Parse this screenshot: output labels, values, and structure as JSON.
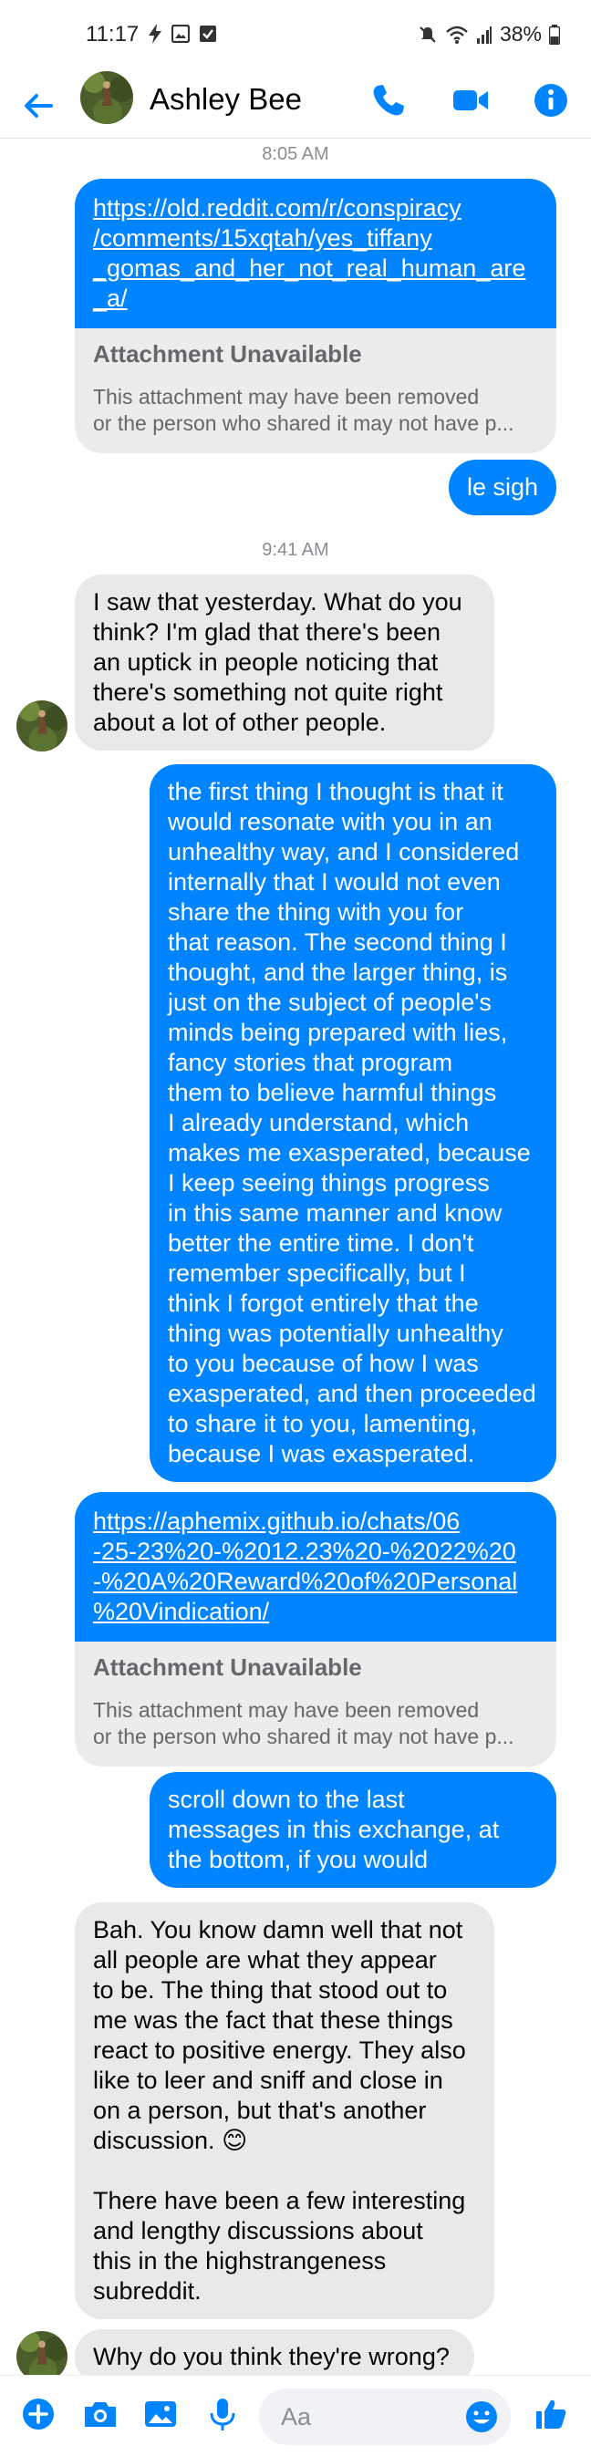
{
  "status_bar": {
    "time": "11:17",
    "battery": "38%",
    "icons": [
      "flash-icon",
      "gallery-icon",
      "checkbox-icon",
      "mute-icon",
      "wifi-icon",
      "signal-icon",
      "battery-icon"
    ]
  },
  "header": {
    "contact_name": "Ashley Bee",
    "icons": [
      "back-arrow-icon",
      "phone-icon",
      "video-icon",
      "info-icon"
    ]
  },
  "colors": {
    "accent": "#0084ff",
    "incoming_bubble": "#e9e9eb",
    "attachment_bg": "#ececec",
    "muted_text": "#65676b"
  },
  "messages": [
    {
      "type": "timestamp",
      "text": "8:05 AM"
    },
    {
      "type": "link_share",
      "direction": "out",
      "url_lines": [
        "https://old.reddit.com/r/conspiracy",
        "/comments/15xqtah/yes_tiffany",
        "_gomas_and_her_not_real_human_are",
        "_a/"
      ],
      "attachment_title": "Attachment Unavailable",
      "attachment_desc_lines": [
        "This attachment may have been removed",
        "or the person who shared it may not have p..."
      ]
    },
    {
      "type": "text",
      "direction": "out",
      "lines": [
        "le sigh"
      ]
    },
    {
      "type": "timestamp",
      "text": "9:41 AM"
    },
    {
      "type": "text",
      "direction": "in",
      "lines": [
        "I saw that yesterday. What do you",
        "think? I'm glad that there's been",
        "an uptick in people noticing that",
        "there's something not quite right",
        "about a lot of other people."
      ]
    },
    {
      "type": "text",
      "direction": "out",
      "lines": [
        "the first thing I thought is that it",
        "would resonate with you in an",
        "unhealthy way, and I considered",
        "internally that I would not even",
        "share the thing with you for",
        "that reason. The second thing I",
        "thought, and the larger thing, is",
        "just on the subject of people's",
        "minds being prepared with lies,",
        "fancy stories that program",
        "them to believe harmful things",
        "I already understand, which",
        "makes me exasperated, because",
        "I keep seeing things progress",
        "in this same manner and know",
        "better the entire time. I don't",
        "remember specifically, but I",
        "think I forgot entirely that the",
        "thing was potentially unhealthy",
        "to you because of how I was",
        "exasperated, and then proceeded",
        "to share it to you, lamenting,",
        "because I was exasperated."
      ]
    },
    {
      "type": "link_share",
      "direction": "out",
      "url_lines": [
        "https://aphemix.github.io/chats/06",
        "-25-23%20-%2012.23%20-%2022%20",
        "-%20A%20Reward%20of%20Personal",
        "%20Vindication/"
      ],
      "attachment_title": "Attachment Unavailable",
      "attachment_desc_lines": [
        "This attachment may have been removed",
        "or the person who shared it may not have p..."
      ]
    },
    {
      "type": "text",
      "direction": "out",
      "lines": [
        "scroll down to the last",
        "messages in this exchange, at",
        "the bottom, if you would"
      ]
    },
    {
      "type": "text",
      "direction": "in",
      "lines": [
        "Bah. You know damn well that not",
        "all people are what they appear",
        "to be. The thing that stood out to",
        "me was the fact that these things",
        "react to positive energy. They also",
        "like to leer and sniff and close in",
        "on a person, but that's another",
        "discussion. 😊",
        "",
        "There have been a few interesting",
        "and lengthy discussions about",
        "this in the highstrangeness",
        "subreddit."
      ]
    },
    {
      "type": "text",
      "direction": "in",
      "lines": [
        "Why do you think they're wrong?"
      ]
    }
  ],
  "composer": {
    "placeholder": "Aa",
    "icons": [
      "plus-icon",
      "camera-icon",
      "image-icon",
      "microphone-icon",
      "emoji-icon",
      "thumbs-up-icon"
    ]
  }
}
